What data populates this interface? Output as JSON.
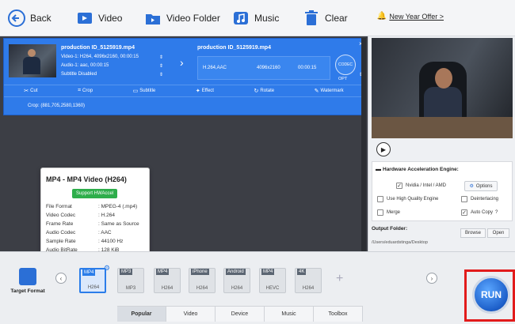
{
  "toolbar": {
    "back": "Back",
    "video": "Video",
    "video_folder": "Video Folder",
    "music": "Music",
    "clear": "Clear",
    "offer": "New Year Offer >"
  },
  "task": {
    "source_name": "production ID_5125919.mp4",
    "video_track": "Video-1: H264, 4096x2160, 00:00:15",
    "audio_track": "Audio-1: aac, 00:00:15",
    "subtitle": "Subtitle Disabled",
    "output_name": "production ID_5125919.mp4",
    "output_codec": "H.264,AAC",
    "output_res": "4096x2160",
    "output_time": "00:00:15",
    "opt_label": "OPT",
    "codec_badge": "CODEC",
    "crop_info": "Crop: (881,705,2580,1360)"
  },
  "edit_bar": {
    "cut": "Cut",
    "crop": "Crop",
    "subtitle": "Subtitle",
    "effect": "Effect",
    "rotate": "Rotate",
    "watermark": "Watermark"
  },
  "popup": {
    "title": "MP4 - MP4 Video (H264)",
    "hw_badge": "Support HWAccel",
    "rows": [
      {
        "k": "File Format",
        "v": ": MPEG-4 (.mp4)"
      },
      {
        "k": "Video Codec",
        "v": ": H.264"
      },
      {
        "k": "Frame Rate",
        "v": ": Same as Source"
      },
      {
        "k": "Audio Codec",
        "v": ": AAC"
      },
      {
        "k": "Sample Rate",
        "v": ": 44100 Hz"
      },
      {
        "k": "Audio BitRate",
        "v": ": 128 KiB"
      }
    ]
  },
  "hw": {
    "title": "Hardware Acceleration Engine:",
    "nvidia": "Nvidia / Intel / AMD",
    "options": "Options",
    "high_quality": "Use High Quality Engine",
    "deinterlacing": "Deinterlacing",
    "merge": "Merge",
    "auto_copy": "Auto Copy"
  },
  "output": {
    "label": "Output Folder:",
    "path": "/Users/eduardstinga/Desktop",
    "browse": "Browse",
    "open": "Open"
  },
  "target_format": "Target Format",
  "formats": [
    {
      "top": "MP4",
      "bottom": "H264"
    },
    {
      "top": "MP3",
      "bottom": "MP3"
    },
    {
      "top": "MP4",
      "bottom": "H264"
    },
    {
      "top": "iPhone",
      "bottom": "H264"
    },
    {
      "top": "Android",
      "bottom": "H264"
    },
    {
      "top": "MP4",
      "bottom": "HEVC"
    },
    {
      "top": "4K",
      "bottom": "H264"
    }
  ],
  "tabs": [
    "Popular",
    "Video",
    "Device",
    "Music",
    "Toolbox"
  ],
  "run": "RUN",
  "colors": {
    "accent": "#2f7bea",
    "run_highlight": "#e21b1b",
    "hw_green": "#2eae4b"
  }
}
